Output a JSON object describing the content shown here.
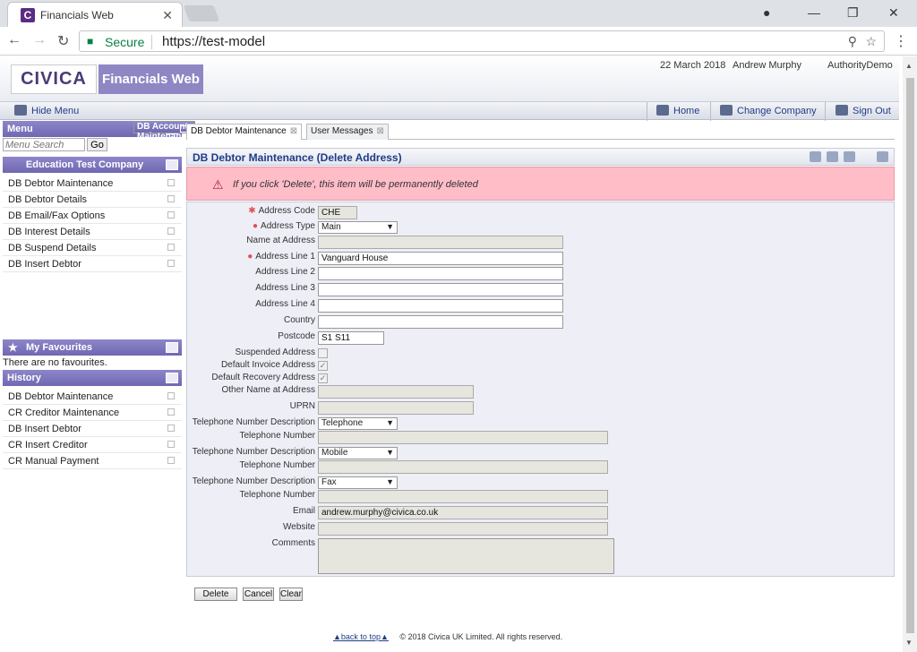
{
  "browser": {
    "tab_title": "Financials Web",
    "favicon_letter": "C",
    "secure_label": "Secure",
    "url": "https://test-model"
  },
  "header": {
    "logo": "CIVICA",
    "brand": "Financials Web",
    "date": "22 March 2018",
    "user": "Andrew Murphy",
    "authority": "AuthorityDemo"
  },
  "toolbar": {
    "hide_menu": "Hide Menu",
    "home": "Home",
    "change_company": "Change Company",
    "sign_out": "Sign Out"
  },
  "sidebar": {
    "menu_title": "Menu",
    "search_placeholder": "Menu Search",
    "go_label": "Go",
    "company": "Education Test Company",
    "menu_items": [
      "DB Account Maintenance",
      "DB Debtor Maintenance",
      "DB Debtor Details",
      "DB Email/Fax Options",
      "DB Interest Details",
      "DB Suspend Details",
      "DB Insert Debtor"
    ],
    "favourites_title": "My Favourites",
    "no_favourites": "There are no favourites.",
    "history_title": "History",
    "history_items": [
      "DB Debtor Maintenance",
      "CR Creditor Maintenance",
      "DB Insert Debtor",
      "CR Insert Creditor",
      "CR Manual Payment"
    ]
  },
  "content": {
    "tabs": [
      "DB Debtor Maintenance",
      "User Messages"
    ],
    "panel_title": "DB Debtor Maintenance (Delete Address)",
    "warning": "If you click 'Delete', this item will be permanently deleted"
  },
  "form": {
    "address_code_label": "Address Code",
    "address_code": "CHE",
    "address_type_label": "Address Type",
    "address_type": "Main",
    "name_at_address_label": "Name at Address",
    "address_line_1_label": "Address Line 1",
    "address_line_1": "Vanguard House",
    "address_line_2_label": "Address Line 2",
    "address_line_3_label": "Address Line 3",
    "address_line_4_label": "Address Line 4",
    "country_label": "Country",
    "postcode_label": "Postcode",
    "postcode": "S1 S11",
    "suspended_label": "Suspended Address",
    "default_invoice_label": "Default Invoice Address",
    "default_recovery_label": "Default Recovery Address",
    "other_name_label": "Other Name at Address",
    "uprn_label": "UPRN",
    "tel_desc_label": "Telephone Number Description",
    "tel_num_label": "Telephone Number",
    "tel_desc_1": "Telephone",
    "tel_desc_2": "Mobile",
    "tel_desc_3": "Fax",
    "email_label": "Email",
    "email": "andrew.murphy@civica.co.uk",
    "website_label": "Website",
    "comments_label": "Comments"
  },
  "actions": {
    "delete": "Delete",
    "cancel": "Cancel",
    "clear": "Clear"
  },
  "footer": {
    "back_to_top": "back to top",
    "copyright": "© 2018 Civica UK Limited. All rights reserved."
  }
}
